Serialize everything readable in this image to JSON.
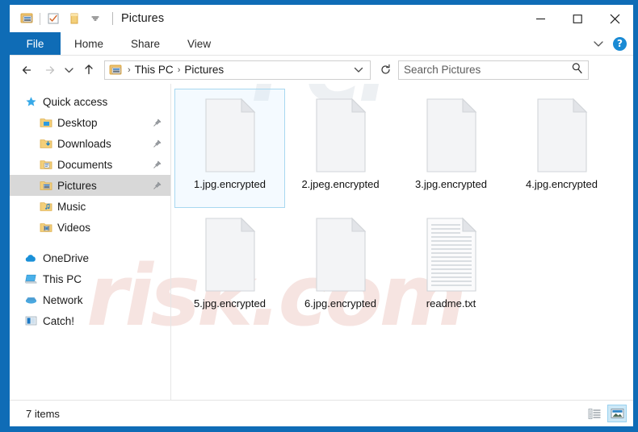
{
  "window": {
    "title": "Pictures",
    "border_color": "#0f6cb6",
    "accent_color": "#0f6cb6"
  },
  "quick_access_toolbar": {
    "items": [
      {
        "name": "properties-icon",
        "label": "Properties"
      },
      {
        "name": "checkbox-icon",
        "label": "Check"
      },
      {
        "name": "new-folder-icon",
        "label": "New folder"
      },
      {
        "name": "customize-chevron-icon",
        "label": "Customize Quick Access Toolbar"
      }
    ]
  },
  "window_controls": {
    "minimize": "Minimize",
    "maximize": "Maximize",
    "close": "Close"
  },
  "ribbon": {
    "tabs": [
      {
        "label": "File",
        "active": true
      },
      {
        "label": "Home",
        "active": false
      },
      {
        "label": "Share",
        "active": false
      },
      {
        "label": "View",
        "active": false
      }
    ],
    "expand_label": "Expand the Ribbon",
    "help_label": "?"
  },
  "address_bar": {
    "back_label": "Back",
    "forward_label": "Forward",
    "recent_label": "Recent locations",
    "up_label": "Up",
    "breadcrumbs": [
      "This PC",
      "Pictures"
    ],
    "separator": "›",
    "refresh_label": "Refresh",
    "dropdown_label": "Previous locations"
  },
  "search": {
    "placeholder": "Search Pictures",
    "icon": "search-icon"
  },
  "sidebar": {
    "groups": [
      {
        "header": {
          "label": "Quick access",
          "icon": "star-icon"
        },
        "items": [
          {
            "label": "Desktop",
            "icon": "folder-desktop-icon",
            "pinned": true,
            "selected": false
          },
          {
            "label": "Downloads",
            "icon": "folder-downloads-icon",
            "pinned": true,
            "selected": false
          },
          {
            "label": "Documents",
            "icon": "folder-documents-icon",
            "pinned": true,
            "selected": false
          },
          {
            "label": "Pictures",
            "icon": "folder-pictures-icon",
            "pinned": true,
            "selected": true
          },
          {
            "label": "Music",
            "icon": "folder-music-icon",
            "pinned": false,
            "selected": false
          },
          {
            "label": "Videos",
            "icon": "folder-videos-icon",
            "pinned": false,
            "selected": false
          }
        ]
      },
      {
        "header": null,
        "items": [
          {
            "label": "OneDrive",
            "icon": "cloud-icon",
            "pinned": false,
            "selected": false
          },
          {
            "label": "This PC",
            "icon": "monitor-icon",
            "pinned": false,
            "selected": false
          },
          {
            "label": "Network",
            "icon": "network-icon",
            "pinned": false,
            "selected": false
          },
          {
            "label": "Catch!",
            "icon": "catch-icon",
            "pinned": false,
            "selected": false
          }
        ]
      }
    ]
  },
  "files": [
    {
      "name": "1.jpg.encrypted",
      "type": "generic",
      "selected": true
    },
    {
      "name": "2.jpeg.encrypted",
      "type": "generic",
      "selected": false
    },
    {
      "name": "3.jpg.encrypted",
      "type": "generic",
      "selected": false
    },
    {
      "name": "4.jpg.encrypted",
      "type": "generic",
      "selected": false
    },
    {
      "name": "5.jpg.encrypted",
      "type": "generic",
      "selected": false
    },
    {
      "name": "6.jpg.encrypted",
      "type": "generic",
      "selected": false
    },
    {
      "name": "readme.txt",
      "type": "text",
      "selected": false
    }
  ],
  "status_bar": {
    "item_count_text": "7 items",
    "view_buttons": [
      {
        "name": "details-view-button",
        "label": "Details view",
        "active": false
      },
      {
        "name": "large-icons-view-button",
        "label": "Large icons view",
        "active": true
      }
    ]
  },
  "watermark": {
    "line1": "PCI",
    "line2": "risk.com"
  }
}
